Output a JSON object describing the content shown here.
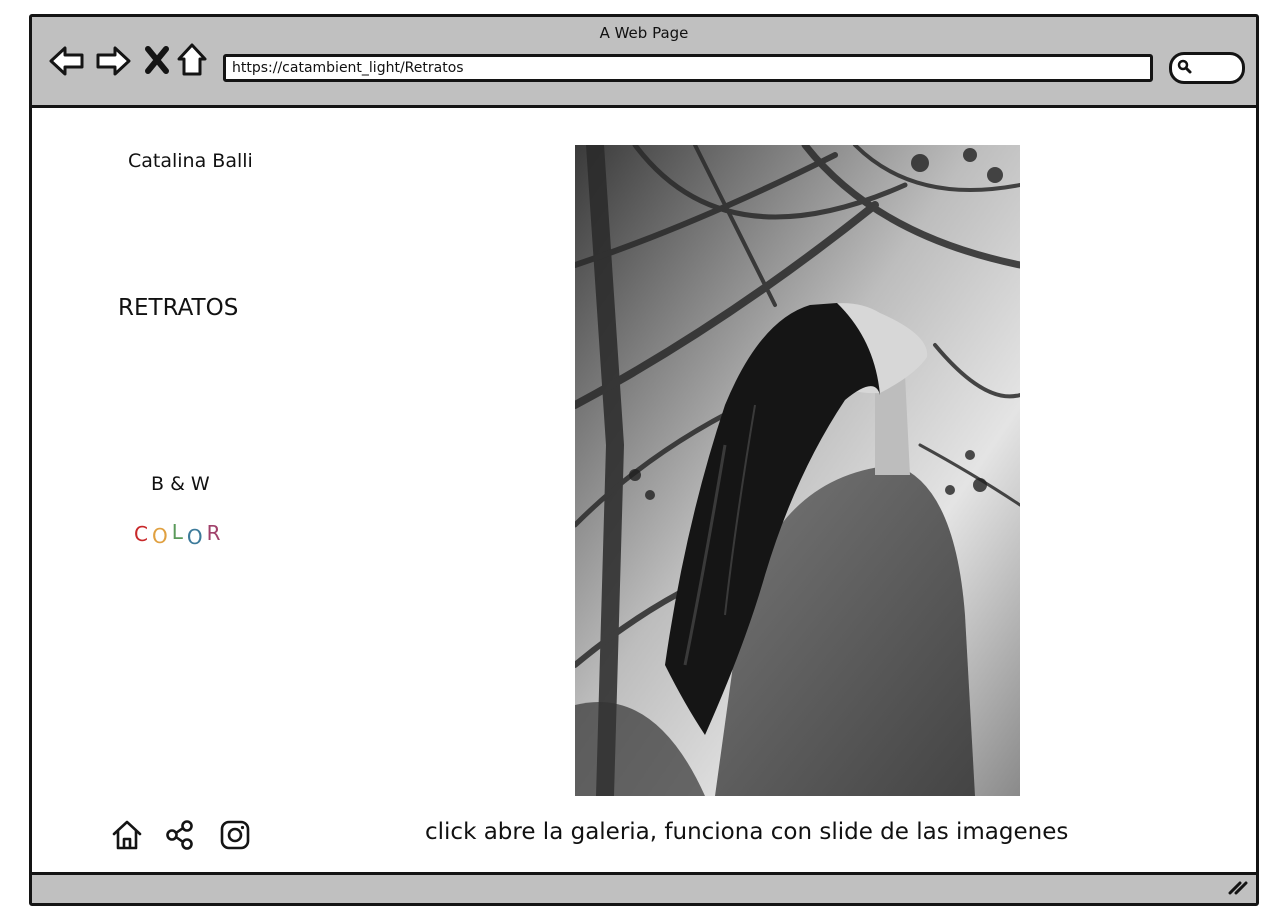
{
  "window": {
    "title": "A Web Page"
  },
  "browser": {
    "url": "https://catambient_light/Retratos",
    "nav_icons": [
      "back-arrow-icon",
      "forward-arrow-icon",
      "stop-icon",
      "home-icon"
    ],
    "search_icon": "search-icon"
  },
  "sidebar": {
    "brand": "Catalina Balli",
    "section": "RETRATOS",
    "filters": {
      "bw": "B & W",
      "color_letters": [
        {
          "char": "C",
          "color": "#c8282a"
        },
        {
          "char": "O",
          "color": "#e0a040"
        },
        {
          "char": "L",
          "color": "#5a9a5a"
        },
        {
          "char": "O",
          "color": "#3c7a9a"
        },
        {
          "char": "R",
          "color": "#a0406a"
        }
      ]
    }
  },
  "gallery": {
    "image_alt": "black and white portrait"
  },
  "footer": {
    "icons": [
      "home-icon",
      "share-icon",
      "instagram-icon"
    ],
    "note": "click abre la galeria, funciona con slide de las imagenes"
  }
}
